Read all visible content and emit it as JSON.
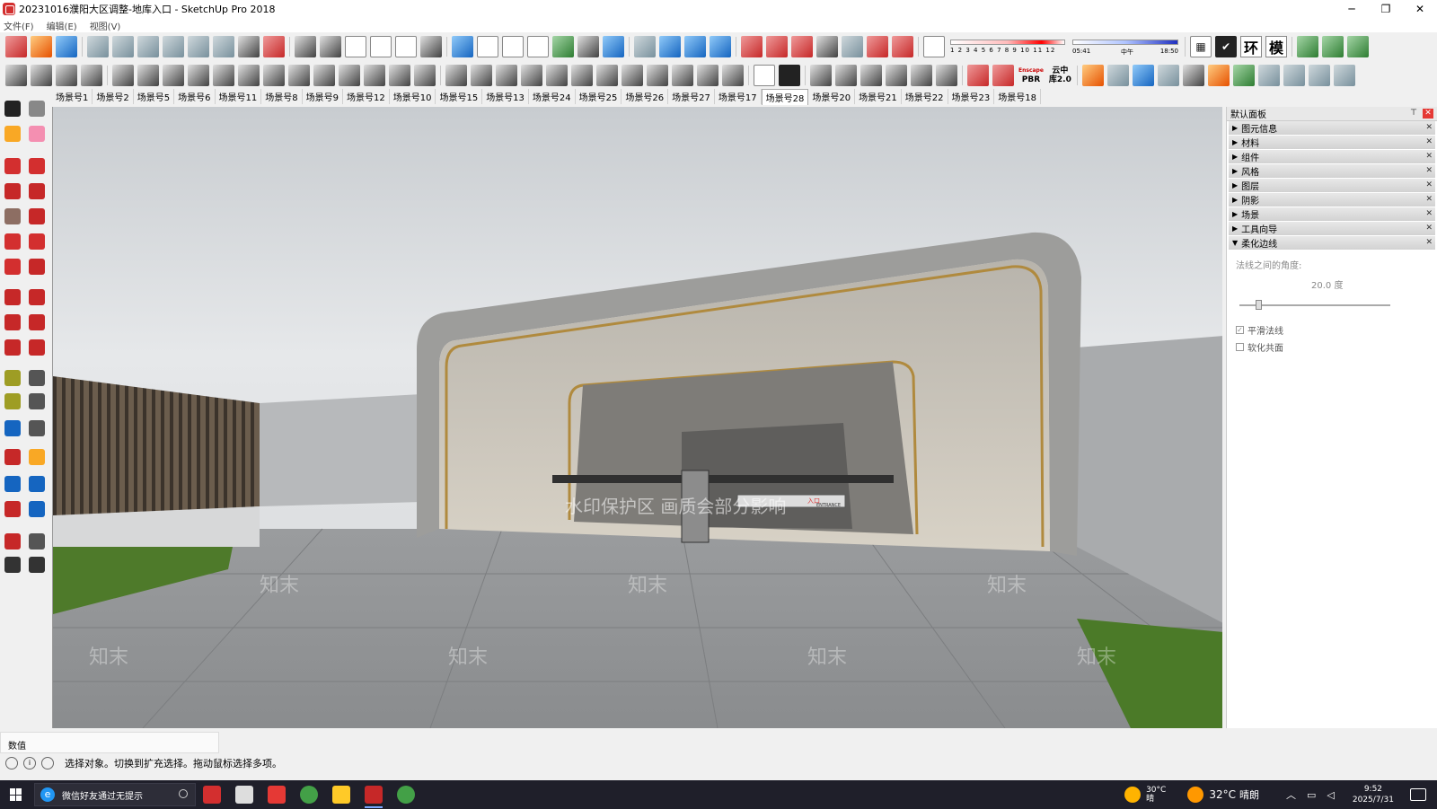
{
  "window": {
    "title": "20231016濮阳大区调整-地库入口 - SketchUp Pro 2018",
    "minimize": "─",
    "maximize": "❐",
    "close": "✕"
  },
  "menu": {
    "items": [
      "文件(F)",
      "编辑(E)",
      "视图(V)"
    ]
  },
  "toolbar1": {
    "shadow_months": "1 2 3 4 5 6 7 8 9 10 11 12",
    "time_start": "05:41",
    "time_mid": "中午",
    "time_end": "18:50",
    "text_icons": [
      "环",
      "模"
    ]
  },
  "toolbar2": {
    "pbr_top": "Enscape",
    "pbr_label": "PBR",
    "cloud_top": "云中",
    "cloud_bottom": "库2.0"
  },
  "scenes": {
    "tabs": [
      "场景号1",
      "场景号2",
      "场景号5",
      "场景号6",
      "场景号11",
      "场景号8",
      "场景号9",
      "场景号12",
      "场景号10",
      "场景号15",
      "场景号13",
      "场景号24",
      "场景号25",
      "场景号26",
      "场景号27",
      "场景号17",
      "场景号28",
      "场景号20",
      "场景号21",
      "场景号22",
      "场景号23",
      "场景号18"
    ],
    "active_index": 16
  },
  "viewport": {
    "watermark_text": "水印保护区 画质会部分影响",
    "watermark_logo": "知末",
    "sign_entrance": "入口",
    "sign_entrance_en": "ENTRANCE"
  },
  "panel": {
    "title": "默认面板",
    "pin": "⊤",
    "close": "✕",
    "trays": [
      "图元信息",
      "材料",
      "组件",
      "风格",
      "图层",
      "阴影",
      "场景",
      "工具向导",
      "柔化边线"
    ],
    "soften": {
      "label": "法线之间的角度:",
      "angle_value": "20.0",
      "angle_unit": "度",
      "slider_fraction": 0.11,
      "smooth_normals": "平滑法线",
      "smooth_normals_checked": true,
      "soften_coplanar": "软化共面",
      "soften_coplanar_checked": false
    }
  },
  "measurements": {
    "label": "数值"
  },
  "status": {
    "message": "选择对象。切换到扩充选择。拖动鼠标选择多项。"
  },
  "taskbar": {
    "search_text": "微信好友通过无提示",
    "weather_temp_small": "30°C",
    "weather_cond_small": "晴",
    "temp": "32°C",
    "condition": "晴朗",
    "time": "9:52",
    "date": "2025/7/31"
  }
}
